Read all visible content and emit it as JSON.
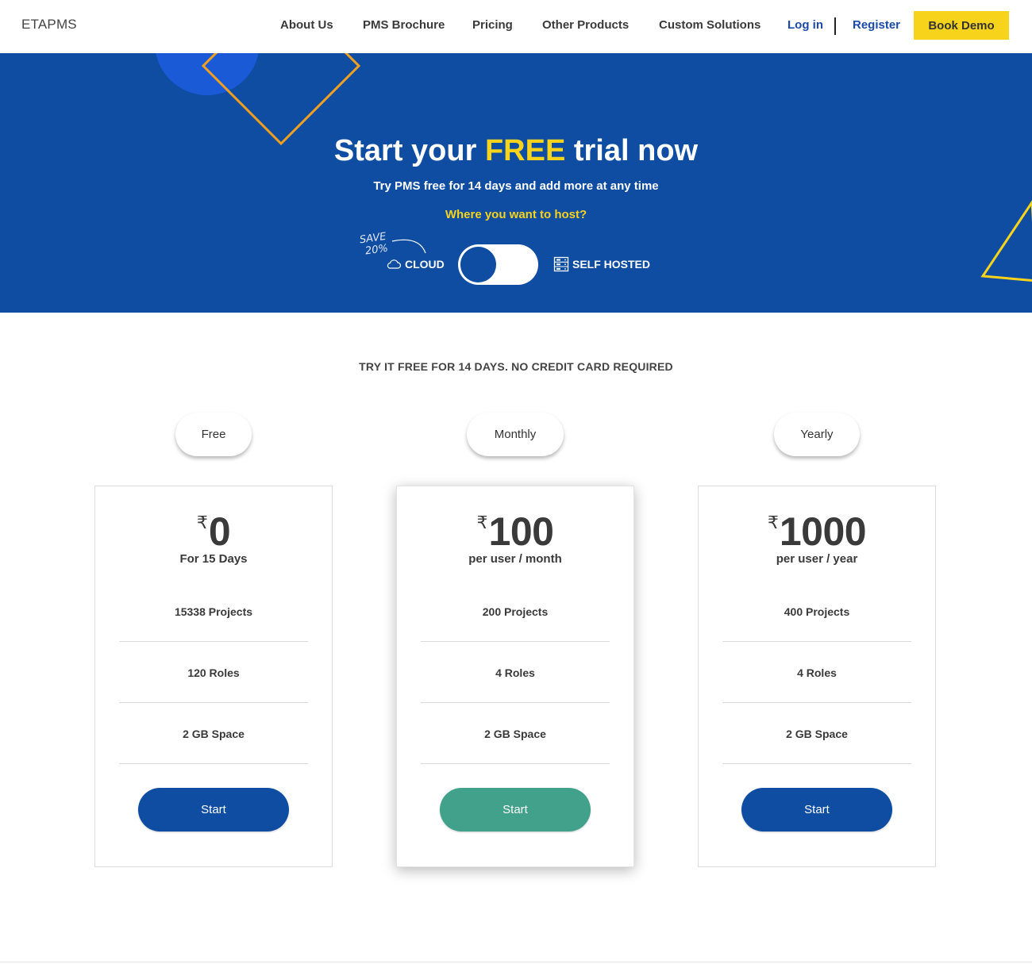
{
  "brand": "ETAPMS",
  "nav": {
    "about": "About Us",
    "brochure": "PMS Brochure",
    "pricing": "Pricing",
    "other": "Other Products",
    "custom": "Custom Solutions",
    "login": "Log in",
    "register": "Register",
    "book_demo": "Book Demo"
  },
  "hero": {
    "title_pre": "Start your",
    "title_free": "FREE",
    "title_post": "trial now",
    "subtitle": "Try PMS free for 14 days and add more at any time",
    "question": "Where you want to host?",
    "save_line1": "SAVE",
    "save_line2": "20%",
    "cloud_label": "CLOUD",
    "self_hosted_label": "SELF HOSTED",
    "toggle_selected": "CLOUD"
  },
  "tagline": "TRY IT FREE FOR 14 DAYS. NO CREDIT CARD REQUIRED",
  "plans": [
    {
      "tab": "Free",
      "currency": "₹",
      "amount": "0",
      "period": "For 15 Days",
      "features": [
        "15338 Projects",
        "120 Roles",
        "2 GB Space"
      ],
      "button": "Start"
    },
    {
      "tab": "Monthly",
      "currency": "₹",
      "amount": "100",
      "period": "per user / month",
      "features": [
        "200 Projects",
        "4 Roles",
        "2 GB Space"
      ],
      "button": "Start"
    },
    {
      "tab": "Yearly",
      "currency": "₹",
      "amount": "1000",
      "period": "per user / year",
      "features": [
        "400 Projects",
        "4 Roles",
        "2 GB Space"
      ],
      "button": "Start"
    }
  ],
  "colors": {
    "brand_blue": "#0e4da2",
    "accent_yellow": "#f8d31c",
    "featured_button": "#42a18a"
  }
}
